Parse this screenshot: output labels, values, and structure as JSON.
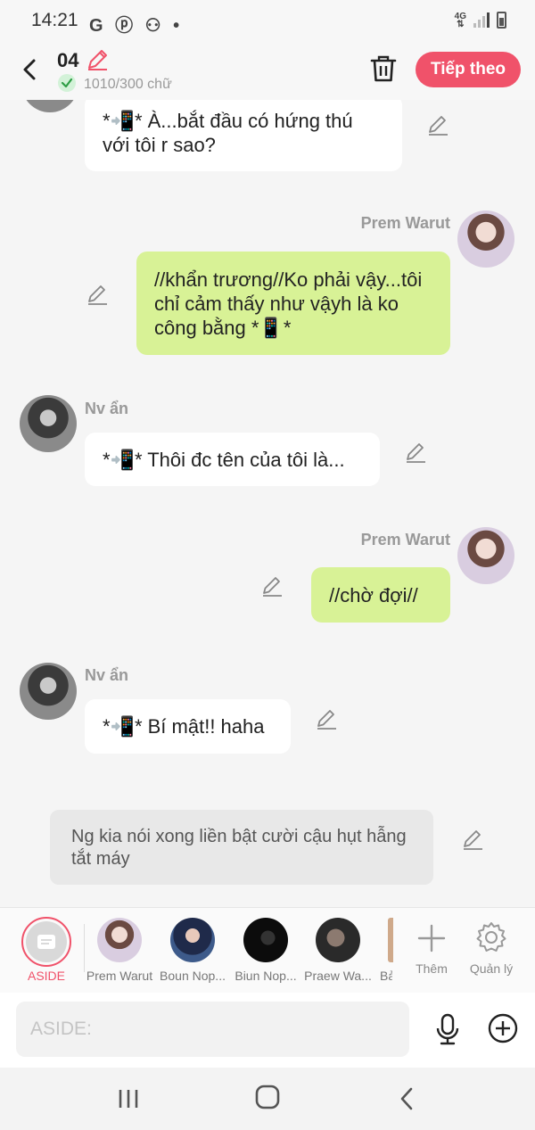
{
  "status_bar": {
    "time": "14:21",
    "left_icons": "G ⓟ ⚇ •",
    "network": "4G"
  },
  "header": {
    "episode": "04",
    "char_count": "1010/300 chữ",
    "next_label": "Tiếp theo"
  },
  "messages": [
    {
      "text": "*📲* À...bắt đầu có hứng thú với tôi r sao?"
    },
    {
      "speaker": "Prem Warut",
      "text": "//khẩn trương//Ko phải vậy...tôi chỉ cảm thấy như vậyh là ko công bằng *📱*"
    },
    {
      "speaker": "Nv ẩn",
      "text": "*📲* Thôi đc tên của tôi là..."
    },
    {
      "speaker": "Prem Warut",
      "text": "//chờ đợi//"
    },
    {
      "speaker": "Nv ẩn",
      "text": "*📲* Bí mật!! haha"
    }
  ],
  "aside": {
    "text": "Ng kia nói xong liền bật cười cậu hụt hẫng tắt máy"
  },
  "characters": {
    "aside_label": "ASIDE",
    "list": [
      "Prem Warut",
      "Boun Nop...",
      "Biun Nop...",
      "Praew Wa...",
      "Bả"
    ],
    "add_label": "Thêm",
    "manage_label": "Quản lý"
  },
  "input": {
    "placeholder": "ASIDE:"
  },
  "colors": {
    "accent": "#f0526a",
    "right_bubble": "#d8f296",
    "left_bubble": "#ffffff"
  }
}
